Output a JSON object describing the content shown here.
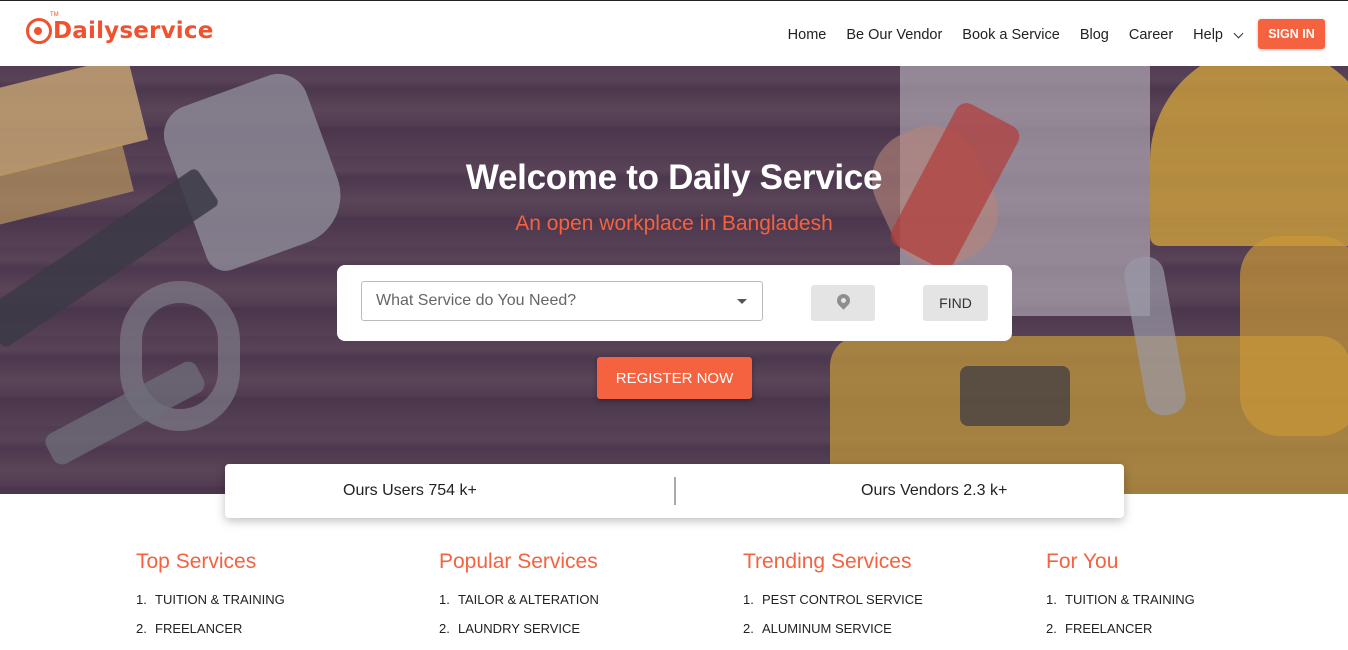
{
  "header": {
    "logo_text": "Dailyservice",
    "logo_tm": "TM",
    "nav": [
      "Home",
      "Be Our Vendor",
      "Book a Service",
      "Blog",
      "Career"
    ],
    "help_label": "Help",
    "signin_label": "SIGN IN"
  },
  "hero": {
    "title": "Welcome to Daily Service",
    "subtitle": "An open workplace in Bangladesh",
    "search_placeholder": "What Service do You Need?",
    "find_label": "FIND",
    "register_label": "REGISTER NOW"
  },
  "stats": {
    "users": "Ours Users 754 k+",
    "vendors": "Ours Vendors 2.3 k+"
  },
  "columns": [
    {
      "title": "Top Services",
      "items": [
        "TUITION & TRAINING",
        "FREELANCER"
      ]
    },
    {
      "title": "Popular Services",
      "items": [
        "TAILOR & ALTERATION",
        "LAUNDRY SERVICE"
      ]
    },
    {
      "title": "Trending Services",
      "items": [
        "PEST CONTROL SERVICE",
        "ALUMINUM SERVICE"
      ]
    },
    {
      "title": "For You",
      "items": [
        "TUITION & TRAINING",
        "FREELANCER"
      ]
    }
  ],
  "colors": {
    "brand": "#f4623f",
    "hero_overlay": "#3c2d5f"
  },
  "icons": [
    "location-pin-icon",
    "chevron-down-icon",
    "dropdown-caret-icon"
  ]
}
